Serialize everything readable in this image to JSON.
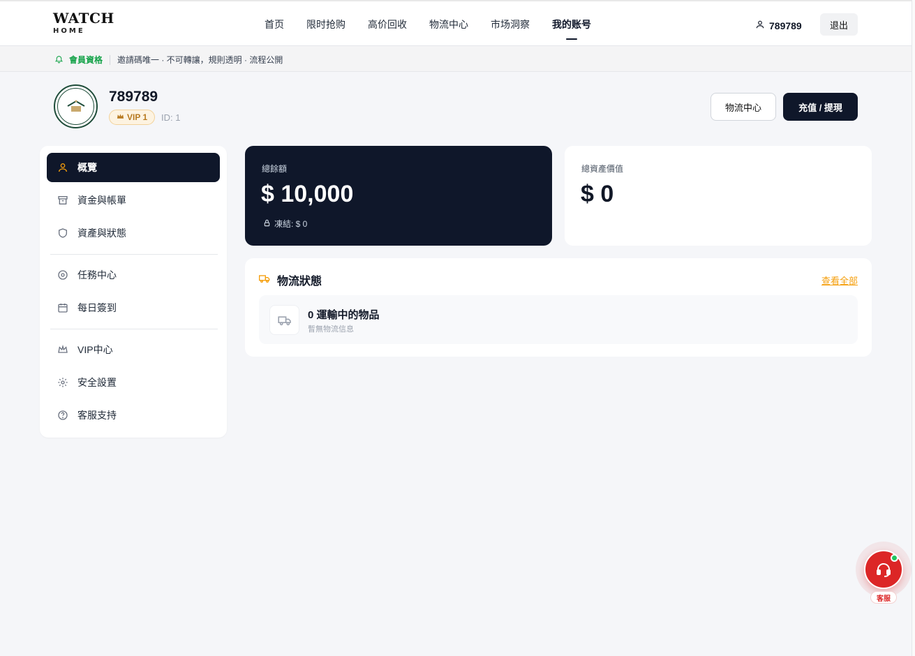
{
  "brand": {
    "name": "WATCH",
    "sub": "HOME"
  },
  "nav": [
    {
      "label": "首页",
      "active": false
    },
    {
      "label": "限时抢购",
      "active": false
    },
    {
      "label": "高价回收",
      "active": false
    },
    {
      "label": "物流中心",
      "active": false
    },
    {
      "label": "市场洞察",
      "active": false
    },
    {
      "label": "我的账号",
      "active": true
    }
  ],
  "header": {
    "username": "789789",
    "logout_label": "退出"
  },
  "notice": {
    "label": "會員資格",
    "text": "邀請碼唯一 · 不可轉讓，規則透明 · 流程公開"
  },
  "profile": {
    "name": "789789",
    "vip": "VIP 1",
    "id_label": "ID: 1"
  },
  "actions": {
    "logistics_label": "物流中心",
    "recharge_label": "充值 / 提現"
  },
  "sidebar": {
    "items": [
      {
        "label": "概覽",
        "icon": "user-icon",
        "active": true
      },
      {
        "label": "資金與帳單",
        "icon": "archive-icon",
        "active": false
      },
      {
        "label": "資產與狀態",
        "icon": "shield-icon",
        "active": false
      },
      {
        "label": "任務中心",
        "icon": "target-icon",
        "active": false
      },
      {
        "label": "每日簽到",
        "icon": "calendar-icon",
        "active": false
      },
      {
        "label": "VIP中心",
        "icon": "crown-icon",
        "active": false
      },
      {
        "label": "安全設置",
        "icon": "gear-icon",
        "active": false
      },
      {
        "label": "客服支持",
        "icon": "help-icon",
        "active": false
      }
    ]
  },
  "balance": {
    "label": "總餘額",
    "value": "$ 10,000",
    "frozen": "凍結: $ 0"
  },
  "assets": {
    "label": "總資產價值",
    "value": "$ 0"
  },
  "logistics": {
    "title": "物流狀態",
    "view_all": "查看全部",
    "count_text": "0 運輸中的物品",
    "empty_text": "暫無物流信息"
  },
  "support": {
    "label": "客服"
  },
  "colors": {
    "primary": "#0f172a",
    "accent": "#f59e0b",
    "success": "#16a34a",
    "support": "#dc2626"
  }
}
